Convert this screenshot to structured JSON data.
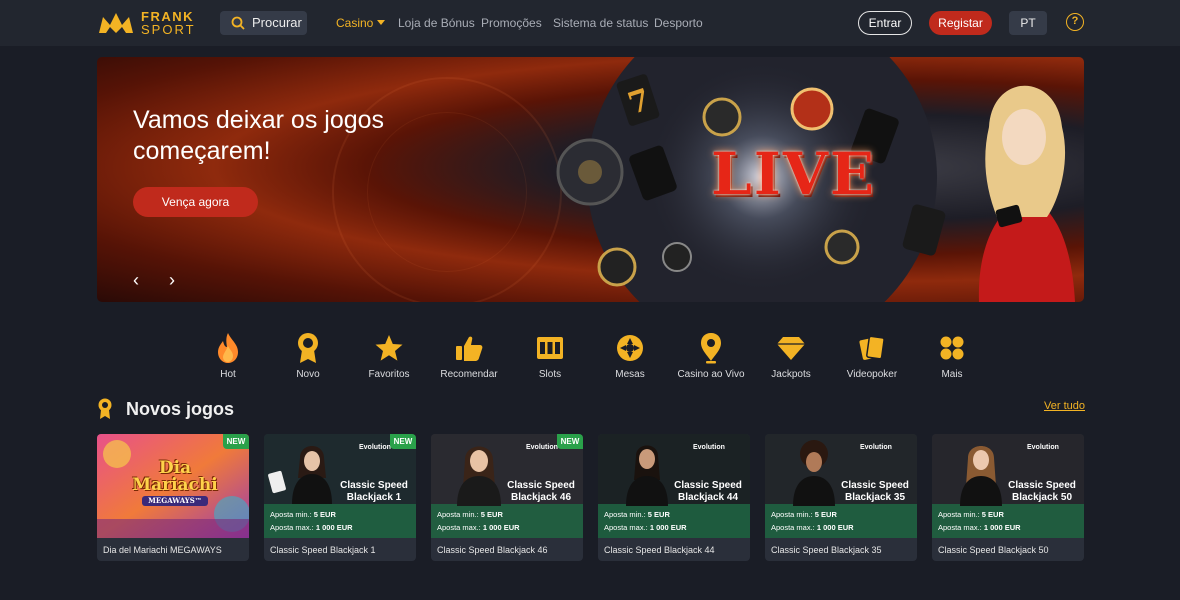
{
  "header": {
    "logo_line1": "FRANK",
    "logo_line2": "SPORT",
    "search_label": "Procurar",
    "nav": [
      "Casino",
      "Loja de Bónus",
      "Promoções",
      "Sistema de status",
      "Desporto"
    ],
    "active_nav": "Casino",
    "login_label": "Entrar",
    "register_label": "Registar",
    "language": "PT",
    "help_label": "?"
  },
  "banner": {
    "title": "Vamos deixar os jogos começarem!",
    "cta_label": "Vença agora",
    "art_text": "LIVE",
    "prev_label": "‹",
    "next_label": "›"
  },
  "categories": [
    {
      "label": "Hot",
      "icon": "flame-icon"
    },
    {
      "label": "Novo",
      "icon": "award-icon"
    },
    {
      "label": "Favoritos",
      "icon": "star-icon"
    },
    {
      "label": "Recomendar",
      "icon": "thumbs-up-icon"
    },
    {
      "label": "Slots",
      "icon": "slots-icon"
    },
    {
      "label": "Mesas",
      "icon": "roulette-icon"
    },
    {
      "label": "Casino ao Vivo",
      "icon": "live-pin-icon"
    },
    {
      "label": "Jackpots",
      "icon": "diamond-icon"
    },
    {
      "label": "Videopoker",
      "icon": "cards-icon"
    },
    {
      "label": "Mais",
      "icon": "grid-icon"
    }
  ],
  "section": {
    "title": "Novos jogos",
    "see_all": "Ver tudo"
  },
  "games": [
    {
      "name": "Dia del Mariachi MEGAWAYS",
      "badge": "NEW",
      "art_line1": "Dia",
      "art_line2": "Mariachi",
      "art_line3": "MEGAWAYS™"
    },
    {
      "name": "Classic Speed Blackjack 1",
      "badge": "NEW",
      "provider": "Evolution",
      "card_title": "Classic Speed Blackjack 1",
      "min_label": "Aposta min.:",
      "min_value": "5 EUR",
      "max_label": "Aposta max.:",
      "max_value": "1 000 EUR"
    },
    {
      "name": "Classic Speed Blackjack 46",
      "badge": "NEW",
      "provider": "Evolution",
      "card_title": "Classic Speed Blackjack 46",
      "min_label": "Aposta min.:",
      "min_value": "5 EUR",
      "max_label": "Aposta max.:",
      "max_value": "1 000 EUR"
    },
    {
      "name": "Classic Speed Blackjack 44",
      "badge": "",
      "provider": "Evolution",
      "card_title": "Classic Speed Blackjack 44",
      "min_label": "Aposta min.:",
      "min_value": "5 EUR",
      "max_label": "Aposta max.:",
      "max_value": "1 000 EUR"
    },
    {
      "name": "Classic Speed Blackjack 35",
      "badge": "",
      "provider": "Evolution",
      "card_title": "Classic Speed Blackjack 35",
      "min_label": "Aposta min.:",
      "min_value": "5 EUR",
      "max_label": "Aposta max.:",
      "max_value": "1 000 EUR"
    },
    {
      "name": "Classic Speed Blackjack 50",
      "badge": "",
      "provider": "Evolution",
      "card_title": "Classic Speed Blackjack 50",
      "min_label": "Aposta min.:",
      "min_value": "5 EUR",
      "max_label": "Aposta max.:",
      "max_value": "1 000 EUR"
    }
  ],
  "colors": {
    "accent": "#f3b324",
    "primary_button": "#c02a1c",
    "background": "#1a1d26",
    "header": "#22262f",
    "new_badge": "#2aa14a"
  }
}
